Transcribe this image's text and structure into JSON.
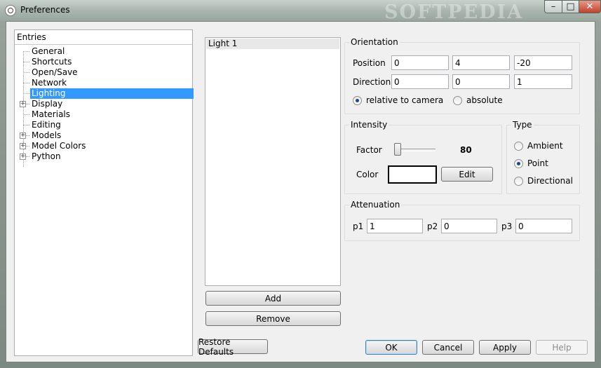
{
  "window": {
    "title": "Preferences",
    "watermark": "SOFTPEDIA",
    "min_glyph": "–",
    "max_glyph": "□",
    "close_glyph": "✕"
  },
  "tree": {
    "header": "Entries",
    "items": [
      {
        "label": "General",
        "expandable": false
      },
      {
        "label": "Shortcuts",
        "expandable": false
      },
      {
        "label": "Open/Save",
        "expandable": false
      },
      {
        "label": "Network",
        "expandable": false
      },
      {
        "label": "Lighting",
        "expandable": false,
        "selected": true
      },
      {
        "label": "Display",
        "expandable": true
      },
      {
        "label": "Materials",
        "expandable": false
      },
      {
        "label": "Editing",
        "expandable": false
      },
      {
        "label": "Models",
        "expandable": true
      },
      {
        "label": "Model Colors",
        "expandable": true
      },
      {
        "label": "Python",
        "expandable": true
      }
    ]
  },
  "lights": {
    "items": [
      "Light 1"
    ],
    "add_label": "Add",
    "remove_label": "Remove"
  },
  "orientation": {
    "title": "Orientation",
    "position_label": "Position",
    "position": [
      "0",
      "4",
      "-20"
    ],
    "direction_label": "Direction",
    "direction": [
      "0",
      "0",
      "1"
    ],
    "relative_label": "relative to camera",
    "absolute_label": "absolute",
    "mode": "relative"
  },
  "intensity": {
    "title": "Intensity",
    "factor_label": "Factor",
    "factor_value": "80",
    "color_label": "Color",
    "edit_label": "Edit",
    "color": "#ffffff"
  },
  "type": {
    "title": "Type",
    "options": [
      "Ambient",
      "Point",
      "Directional"
    ],
    "selected": "Point"
  },
  "attenuation": {
    "title": "Attenuation",
    "p1_label": "p1",
    "p1": "1",
    "p2_label": "p2",
    "p2": "0",
    "p3_label": "p3",
    "p3": "0"
  },
  "footer": {
    "restore_label": "Restore Defaults",
    "ok_label": "OK",
    "cancel_label": "Cancel",
    "apply_label": "Apply",
    "help_label": "Help"
  }
}
